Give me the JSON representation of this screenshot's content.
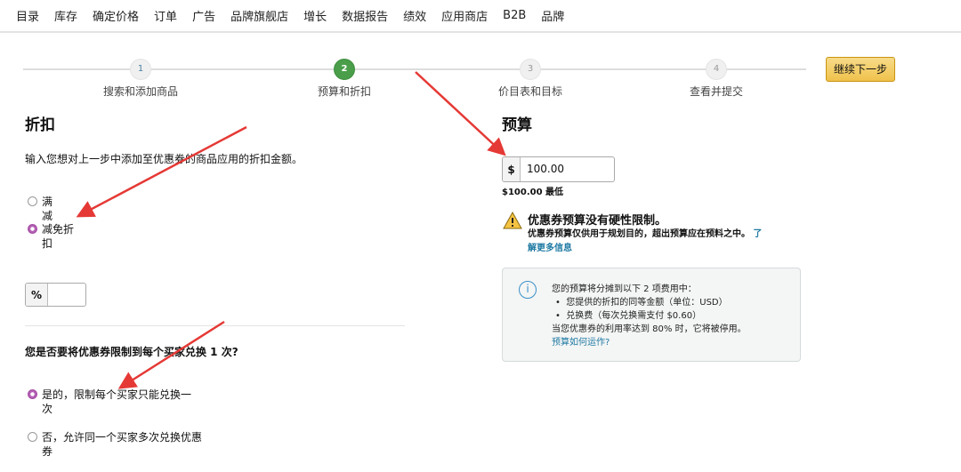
{
  "nav": [
    "目录",
    "库存",
    "确定价格",
    "订单",
    "广告",
    "品牌旗舰店",
    "增长",
    "数据报告",
    "绩效",
    "应用商店",
    "B2B",
    "品牌"
  ],
  "steps": [
    {
      "num": "1",
      "label": "搜索和添加商品"
    },
    {
      "num": "2",
      "label": "预算和折扣"
    },
    {
      "num": "3",
      "label": "价目表和目标"
    },
    {
      "num": "4",
      "label": "查看并提交"
    }
  ],
  "next_button": "继续下一步",
  "discount": {
    "title": "折扣",
    "description": "输入您想对上一步中添加至优惠券的商品应用的折扣金额。",
    "option1": [
      "满",
      "减"
    ],
    "option2": [
      "减免折",
      "扣"
    ],
    "percent_symbol": "%",
    "percent_value": "",
    "question": "您是否要将优惠券限制到每个买家兑换 1 次?",
    "yes": [
      "是的，限制每个买家只能兑换一",
      "次"
    ],
    "no": [
      "否，允许同一个买家多次兑换优惠",
      "券"
    ]
  },
  "budget": {
    "title": "预算",
    "currency": "$",
    "value": "100.00",
    "minimum": "$100.00 最低",
    "warning_title": "优惠券预算没有硬性限制。",
    "warning_text": "优惠券预算仅供用于规划目的，超出预算应在预料之中。",
    "learn_more": [
      "了",
      "解更多信息"
    ],
    "info_intro": "您的预算将分摊到以下 2 项费用中：",
    "info_items": [
      "您提供的折扣的同等金额（单位：USD）",
      "兑换费（每次兑换需支付 $0.60）"
    ],
    "info_note": "当您优惠券的利用率达到 80% 时，它将被停用。",
    "info_link": "预算如何运作?"
  }
}
